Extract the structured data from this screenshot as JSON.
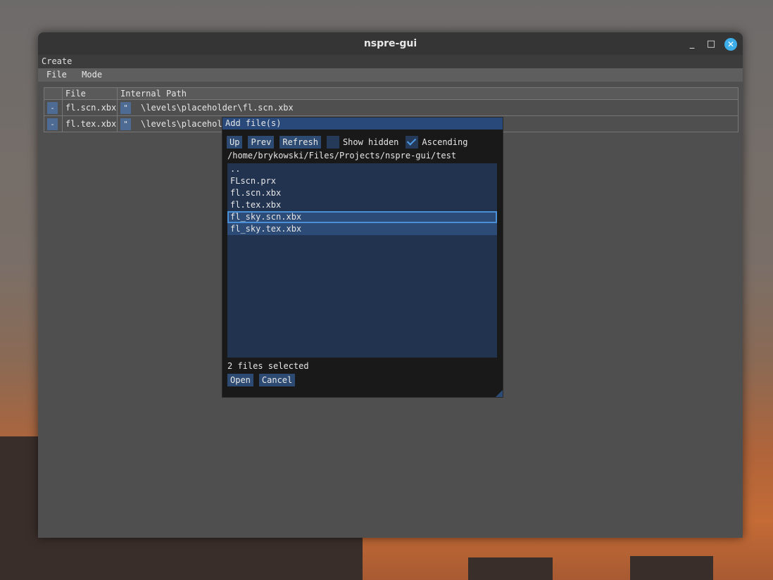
{
  "window": {
    "title": "nspre-gui"
  },
  "menubar_top": {
    "label": "Create"
  },
  "menubar": {
    "items": [
      "File",
      "Mode"
    ]
  },
  "table": {
    "headers": [
      "",
      "File",
      "Internal Path"
    ],
    "rows": [
      {
        "remove": "-",
        "file": "fl.scn.xbx",
        "quote": "\"",
        "path": "\\levels\\placeholder\\fl.scn.xbx"
      },
      {
        "remove": "-",
        "file": "fl.tex.xbx",
        "quote": "\"",
        "path": "\\levels\\placehol"
      }
    ]
  },
  "dialog": {
    "title": "Add file(s)",
    "buttons": {
      "up": "Up",
      "prev": "Prev",
      "refresh": "Refresh"
    },
    "show_hidden": {
      "label": "Show hidden",
      "checked": false
    },
    "ascending": {
      "label": "Ascending",
      "checked": true
    },
    "path": "/home/brykowski/Files/Projects/nspre-gui/test",
    "files": [
      "..",
      "FLscn.prx",
      "fl.scn.xbx",
      "fl.tex.xbx",
      "fl_sky.scn.xbx",
      "fl_sky.tex.xbx"
    ],
    "selected": [
      "fl_sky.scn.xbx",
      "fl_sky.tex.xbx"
    ],
    "status": "2 files selected",
    "open": "Open",
    "cancel": "Cancel"
  },
  "colors": {
    "accent": "#3daee9",
    "dialog_title": "#28497a",
    "selection": "#2c4b76"
  },
  "icons": {
    "minimize": "minimize-icon",
    "maximize": "maximize-icon",
    "close": "close-icon",
    "check": "check-icon"
  }
}
